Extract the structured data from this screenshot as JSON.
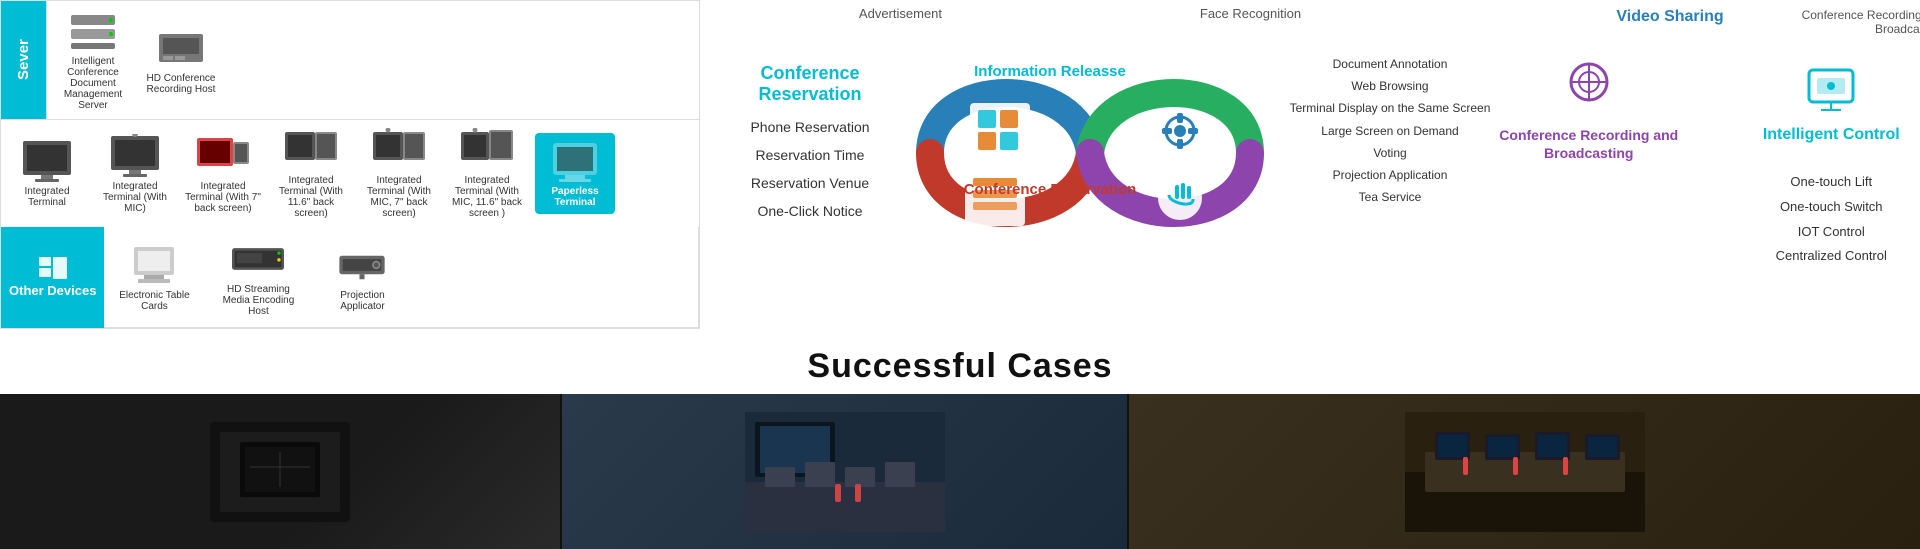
{
  "productGrid": {
    "serverLabel": "Sever",
    "serverItems": [
      {
        "name": "Intelligent Conference Document Management Server",
        "type": "server"
      },
      {
        "name": "HD Conference Recording Host",
        "type": "server"
      }
    ],
    "terminalItems": [
      {
        "name": "Integrated Terminal",
        "type": "monitor"
      },
      {
        "name": "Integrated Terminal (With MIC)",
        "type": "monitor"
      },
      {
        "name": "Integrated Terminal (With 7\" back screen)",
        "type": "monitor"
      },
      {
        "name": "Integrated Terminal (With 11.6\" back screen)",
        "type": "monitor"
      },
      {
        "name": "Integrated Terminal (With MIC, 7\" back screen)",
        "type": "monitor"
      },
      {
        "name": "Integrated Terminal (With MIC, 11.6\" back screen )",
        "type": "monitor",
        "highlighted": true
      },
      {
        "name": "Paperless Terminal",
        "type": "special",
        "highlighted": true
      }
    ],
    "otherDevicesLabel": "Other Devices",
    "otherItems": [
      {
        "name": "Electronic Table Cards",
        "type": "card"
      },
      {
        "name": "HD Streaming Media Encoding Host",
        "type": "box"
      },
      {
        "name": "Projection Applicator",
        "type": "box"
      }
    ]
  },
  "diagram": {
    "topLabels": {
      "advertisement": "Advertisement",
      "faceRecognition": "Face Recognition",
      "videoSharing": "Video Sharing",
      "confRecBcast": "Conference Recording and Broadcasting"
    },
    "leftSection": {
      "title": "Conference Reservation",
      "items": [
        "Phone Reservation",
        "Reservation Time",
        "Reservation Venue",
        "One-Click Notice"
      ]
    },
    "centerTop": {
      "title": "Information Releasse"
    },
    "centerBottom": {
      "title": "Conference Reservation",
      "items": [
        "Document Annotation",
        "Web Browsing",
        "Terminal Display on the Same Screen",
        "Large Screen on Demand",
        "Voting",
        "Projection Application",
        "Tea Service"
      ]
    },
    "rightSection": {
      "title": "Intelligent Control",
      "items": [
        "One-touch Lift",
        "One-touch Switch",
        "IOT Control",
        "Centralized Control"
      ]
    },
    "rightTopSection": {
      "title": "Conference Recording and Broadcasting",
      "videoSharing": "Video Sharing"
    }
  },
  "successfulCases": {
    "title": "Successful Cases"
  }
}
